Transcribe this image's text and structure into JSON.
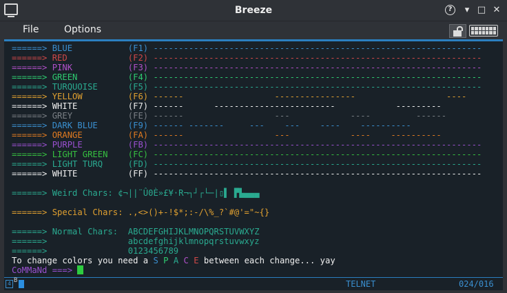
{
  "window": {
    "title": "Breeze"
  },
  "menu": {
    "file": "File",
    "options": "Options"
  },
  "window_buttons": {
    "help": "?",
    "chevron": "⌄",
    "minimize": "▾",
    "maximize": "□",
    "close": "✕"
  },
  "terminal": {
    "arrow": "======>",
    "color_lines": [
      {
        "arrow_color": "#3a8fd0",
        "name": "BLUE",
        "name_color": "#3a8fd0",
        "fkey": "(F1)",
        "fkey_color": "#3a8fd0",
        "dashes": "-----------------------------------------------------------------",
        "dash_color": "#3a8fd0"
      },
      {
        "arrow_color": "#d04848",
        "name": "RED",
        "name_color": "#d04848",
        "fkey": "(F2)",
        "fkey_color": "#d04848",
        "dashes": "-----------------------------------------------------------------",
        "dash_color": "#d04848"
      },
      {
        "arrow_color": "#b050c8",
        "name": "PINK",
        "name_color": "#b050c8",
        "fkey": "(F3)",
        "fkey_color": "#b050c8",
        "dashes": "-----------------------------------------------------------------",
        "dash_color": "#b050c8"
      },
      {
        "arrow_color": "#2ecc71",
        "name": "GREEN",
        "name_color": "#2ecc71",
        "fkey": "(F4)",
        "fkey_color": "#2ecc71",
        "dashes": "-----------------------------------------------------------------",
        "dash_color": "#2ecc71"
      },
      {
        "arrow_color": "#2aaa90",
        "name": "TURQUOISE",
        "name_color": "#2aaa90",
        "fkey": "(F5)",
        "fkey_color": "#2aaa90",
        "dashes": "-----------------------------------------------------------------",
        "dash_color": "#2aaa90"
      },
      {
        "arrow_color": "#e0a030",
        "name": "YELLOW",
        "name_color": "#e0a030",
        "fkey": "(F6)",
        "fkey_color": "#e0a030",
        "dashes": "------                  ----------------                  ----",
        "dash_color": "#e0a030"
      },
      {
        "arrow_color": "#f0f0f0",
        "name": "WHITE",
        "name_color": "#f0f0f0",
        "fkey": "(F7)",
        "fkey_color": "#f0f0f0",
        "dashes": "------      ------------------------            ---------",
        "dash_color": "#f0f0f0"
      },
      {
        "arrow_color": "#7a7f85",
        "name": "GREY",
        "name_color": "#7a7f85",
        "fkey": "(FE)",
        "fkey_color": "#7a7f85",
        "dashes": "------                  ---            ----         ------",
        "dash_color": "#7a7f85"
      },
      {
        "arrow_color": "#3a8fd0",
        "name": "DARK BLUE",
        "name_color": "#3a8fd0",
        "fkey": "(F9)",
        "fkey_color": "#3a8fd0",
        "dashes": "------ -------     ---    ---    ----    ----------",
        "dash_color": "#3a8fd0"
      },
      {
        "arrow_color": "#e07a20",
        "name": "ORANGE",
        "name_color": "#e07a20",
        "fkey": "(FA)",
        "fkey_color": "#e07a20",
        "dashes": "------                  ---            ----    ----------",
        "dash_color": "#e07a20"
      },
      {
        "arrow_color": "#9a50d0",
        "name": "PURPLE",
        "name_color": "#9a50d0",
        "fkey": "(FB)",
        "fkey_color": "#9a50d0",
        "dashes": "-----------------------------------------------------------------",
        "dash_color": "#9a50d0"
      },
      {
        "arrow_color": "#36c040",
        "name": "LIGHT GREEN",
        "name_color": "#36c040",
        "fkey": "(FC)",
        "fkey_color": "#36c040",
        "dashes": "-----------------------------------------------------------------",
        "dash_color": "#36c040"
      },
      {
        "arrow_color": "#2aaa90",
        "name": "LIGHT TURQ",
        "name_color": "#2aaa90",
        "fkey": "(FD)",
        "fkey_color": "#2aaa90",
        "dashes": "-----------------------------------------------------------------",
        "dash_color": "#2aaa90"
      },
      {
        "arrow_color": "#f0f0f0",
        "name": "WHITE",
        "name_color": "#f0f0f0",
        "fkey": "(FF)",
        "fkey_color": "#f0f0f0",
        "dashes": "-----------------------------------------------------------------",
        "dash_color": "#f0f0f0"
      }
    ],
    "weird": {
      "color": "#2aaa90",
      "label": "Weird Chars:",
      "chars": "¢¬||¨Û0È»£¥·R¬┐┘┌└─|▯▌ ▛▙▄▄▄"
    },
    "special": {
      "color": "#e0a030",
      "label": "Special Chars:",
      "chars": ".,<>()+-!$*;:-/\\%_?`#@'=\"~{}"
    },
    "normal": {
      "color": "#2aaa90",
      "label": "Normal Chars:",
      "upper": "ABCDEFGHIJKLMNOPQRSTUVWXYZ",
      "lower": "abcdefghijklmnopqrstuvwxyz",
      "digits": "0123456789"
    },
    "message": {
      "before": "To change colors you need a ",
      "space_letters": [
        {
          "ch": "S",
          "color": "#3a8fd0"
        },
        {
          "ch": "P",
          "color": "#2ecc71"
        },
        {
          "ch": "A",
          "color": "#2aaa90"
        },
        {
          "ch": "C",
          "color": "#b050c8"
        },
        {
          "ch": "E",
          "color": "#d04848"
        }
      ],
      "after": " between each change... yay"
    },
    "prompt": "CoMMaNd ===>",
    "prompt_color": "#9a50d0"
  },
  "status": {
    "indicator": "B",
    "mode": "TELNET",
    "position": "024/016"
  }
}
